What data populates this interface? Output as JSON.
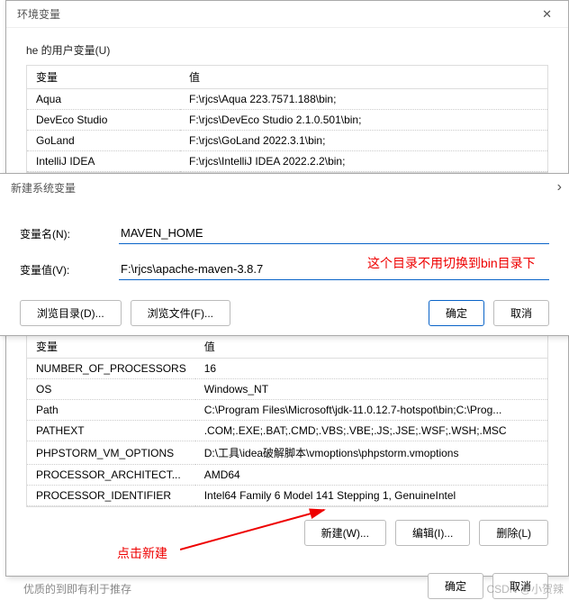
{
  "dialog1": {
    "title": "环境变量",
    "close": "✕",
    "user_vars_label": "he 的用户变量(U)",
    "header_var": "变量",
    "header_val": "值",
    "user_rows": [
      {
        "var": "Aqua",
        "val": "F:\\rjcs\\Aqua 223.7571.188\\bin;"
      },
      {
        "var": "DevEco Studio",
        "val": "F:\\rjcs\\DevEco Studio 2.1.0.501\\bin;"
      },
      {
        "var": "GoLand",
        "val": "F:\\rjcs\\GoLand 2022.3.1\\bin;"
      },
      {
        "var": "IntelliJ IDEA",
        "val": "F:\\rjcs\\IntelliJ IDEA 2022.2.2\\bin;"
      }
    ],
    "sys_rows": [
      {
        "var": "NUMBER_OF_PROCESSORS",
        "val": "16"
      },
      {
        "var": "OS",
        "val": "Windows_NT"
      },
      {
        "var": "Path",
        "val": "C:\\Program Files\\Microsoft\\jdk-11.0.12.7-hotspot\\bin;C:\\Prog..."
      },
      {
        "var": "PATHEXT",
        "val": ".COM;.EXE;.BAT;.CMD;.VBS;.VBE;.JS;.JSE;.WSF;.WSH;.MSC"
      },
      {
        "var": "PHPSTORM_VM_OPTIONS",
        "val": "D:\\工具\\idea破解脚本\\vmoptions\\phpstorm.vmoptions"
      },
      {
        "var": "PROCESSOR_ARCHITECT...",
        "val": "AMD64"
      },
      {
        "var": "PROCESSOR_IDENTIFIER",
        "val": "Intel64 Family 6 Model 141 Stepping 1, GenuineIntel"
      }
    ],
    "btn_new": "新建(W)...",
    "btn_edit": "编辑(I)...",
    "btn_del": "删除(L)",
    "btn_ok": "确定",
    "btn_cancel": "取消"
  },
  "dialog2": {
    "title": "新建系统变量",
    "expand": "›",
    "name_label": "变量名(N):",
    "name_value": "MAVEN_HOME",
    "value_label": "变量值(V):",
    "value_value": "F:\\rjcs\\apache-maven-3.8.7",
    "browse_dir": "浏览目录(D)...",
    "browse_file": "浏览文件(F)...",
    "ok": "确定",
    "cancel": "取消"
  },
  "annotations": {
    "a1": "这个目录不用切换到bin目录下",
    "a2": "点击新建"
  },
  "watermark": "CSDN @小贺辣",
  "back_text": "优质的到即有利于推存"
}
